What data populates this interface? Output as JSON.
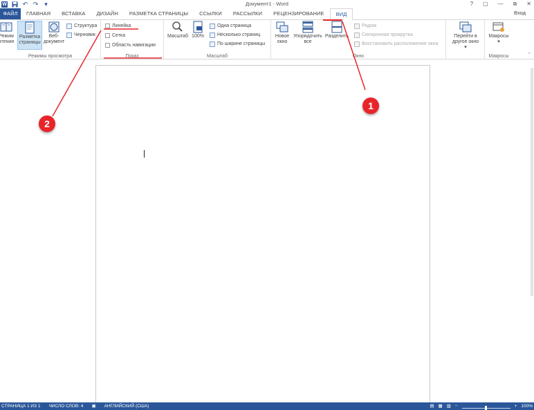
{
  "titlebar": {
    "logo_letter": "W",
    "document_title": "Документ1 - Word",
    "undo_symbol": "↶",
    "redo_symbol": "↷",
    "save_symbol": "▪",
    "controls": [
      "?",
      "▢",
      "—",
      "⧉",
      "✕"
    ]
  },
  "tabs": [
    {
      "label": "ФАЙЛ"
    },
    {
      "label": "ГЛАВНАЯ"
    },
    {
      "label": "ВСТАВКА"
    },
    {
      "label": "ДИЗАЙН"
    },
    {
      "label": "РАЗМЕТКА СТРАНИЦЫ"
    },
    {
      "label": "ССЫЛКИ"
    },
    {
      "label": "РАССЫЛКИ"
    },
    {
      "label": "РЕЦЕНЗИРОВАНИЕ"
    },
    {
      "label": "ВИД"
    }
  ],
  "login_label": "Вход",
  "ribbon": {
    "views": {
      "label": "Режимы просмотра",
      "read_mode": "Режим чтения",
      "read_mode_line1": "Режим",
      "read_mode_line2": "чтения",
      "print_layout_line1": "Разметка",
      "print_layout_line2": "страницы",
      "web_layout_line1": "Веб-",
      "web_layout_line2": "документ",
      "outline": "Структура",
      "draft": "Черновик"
    },
    "show": {
      "label": "Показ",
      "ruler": "Линейка",
      "gridlines": "Сетка",
      "navigation_pane": "Область навигации"
    },
    "zoom": {
      "label": "Масштаб",
      "zoom_button": "Масштаб",
      "percent_button": "100%",
      "one_page": "Одна страница",
      "multiple_pages": "Несколько страниц",
      "page_width": "По ширине страницы"
    },
    "window": {
      "label": "Окно",
      "new_window_line1": "Новое",
      "new_window_line2": "окно",
      "arrange_all_line1": "Упорядочить",
      "arrange_all_line2": "все",
      "split": "Разделить",
      "side_by_side": "Рядом",
      "sync_scroll": "Синхронная прокрутка",
      "reset_position": "Восстановить расположение окна",
      "switch_windows_line1": "Перейти в",
      "switch_windows_line2": "другое окно"
    },
    "macros": {
      "label": "Макросы",
      "macros_button": "Макросы"
    }
  },
  "statusbar": {
    "page": "СТРАНИЦА 1 ИЗ 1",
    "words": "ЧИСЛО СЛОВ: 4",
    "language": "АНГЛИЙСКИЙ (США)",
    "zoom_minus": "−",
    "zoom_plus": "+",
    "zoom_level": "100%",
    "zoom_fraction": 0.5
  },
  "annotations": {
    "badge_1": "1",
    "badge_2": "2",
    "color": "#e8242a"
  },
  "colors": {
    "accent": "#2b579a",
    "selected_bg": "#cde3f6"
  }
}
